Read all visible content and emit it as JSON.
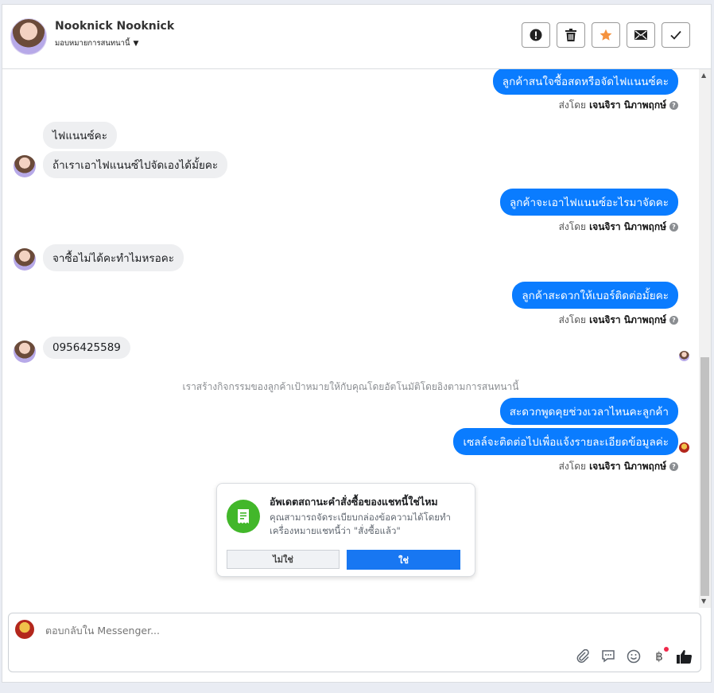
{
  "header": {
    "name": "Nooknick Nooknick",
    "assign_label": "มอบหมายการสนทนานี้",
    "actions": [
      "report-icon",
      "trash-icon",
      "star-icon",
      "mail-icon",
      "check-icon"
    ]
  },
  "messages": {
    "out1": "ลูกค้าสนใจซื้อสดหรือจัดไฟแนนซ์คะ",
    "in1": "ไฟแนนซ์คะ",
    "in2": "ถ้าเราเอาไฟแนนซ์ไปจัดเองได้มั้ยคะ",
    "out2": "ลูกค้าจะเอาไฟแนนซ์อะไรมาจัดคะ",
    "in3": "จาซื้อไม่ได้คะทำไมหรอคะ",
    "out3": "ลูกค้าสะดวกให้เบอร์ติดต่อมั้ยคะ",
    "in4": "0956425589",
    "out4": "สะดวกพูดคุยช่วงเวลาไหนคะลูกค้า",
    "out5": "เซลล์จะติดต่อไปเพื่อแจ้งรายละเอียดข้อมูลค่ะ"
  },
  "sent_by": {
    "prefix": "ส่งโดย",
    "agent": "เจนจิรา นิภาพฤกษ์"
  },
  "system_note": "เราสร้างกิจกรรมของลูกค้าเป้าหมายให้กับคุณโดยอัตโนมัติโดยอิงตามการสนทนานี้",
  "card": {
    "title": "อัพเดตสถานะคำสั่งซื้อของแชทนี้ใช่ไหม",
    "body": "คุณสามารถจัดระเบียบกล่องข้อความได้โดยทำเครื่องหมายแชทนี้ว่า \"สั่งซื้อแล้ว\"",
    "no_label": "ไม่ใช่",
    "yes_label": "ใช่",
    "icon": "receipt-icon",
    "icon_color": "#42b72a"
  },
  "composer": {
    "placeholder": "ตอบกลับใน Messenger...",
    "tools": [
      "attach-icon",
      "saved-reply-icon",
      "emoji-icon",
      "baht-icon",
      "like-icon"
    ]
  },
  "colors": {
    "outgoing": "#0a7cff",
    "incoming": "#eeeff1",
    "primary": "#1877f2"
  }
}
